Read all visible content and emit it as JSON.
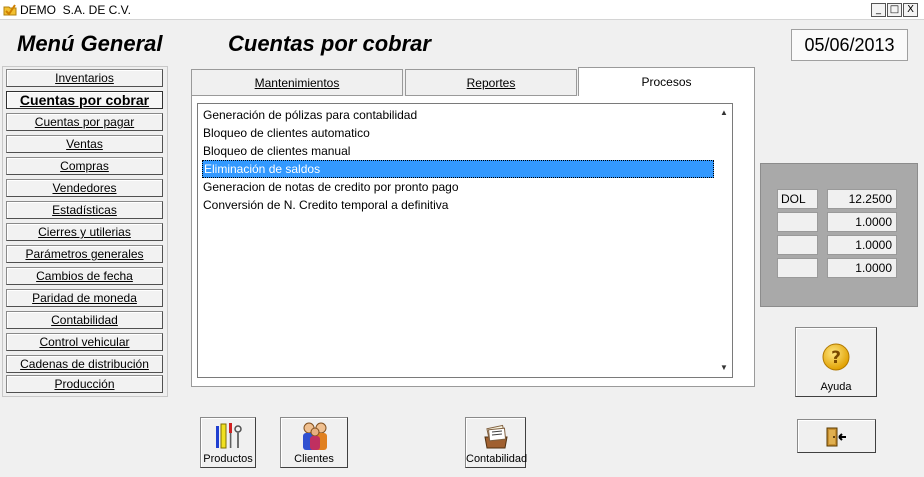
{
  "window": {
    "title": "DEMO  S.A. DE C.V.",
    "minimize": "_",
    "maximize": "□",
    "close": "X"
  },
  "header": {
    "menu_title": "Menú General",
    "section_title": "Cuentas por cobrar",
    "date": "05/06/2013"
  },
  "menu": {
    "items": [
      {
        "label": "Inventarios"
      },
      {
        "label": "Cuentas por cobrar",
        "active": true
      },
      {
        "label": "Cuentas por pagar"
      },
      {
        "label": "Ventas"
      },
      {
        "label": "Compras"
      },
      {
        "label": "Vendedores"
      },
      {
        "label": "Estadísticas"
      },
      {
        "label": "Cierres y utilerias"
      },
      {
        "label": "Parámetros generales"
      },
      {
        "label": "Cambios de fecha"
      },
      {
        "label": "Paridad de moneda"
      },
      {
        "label": "Contabilidad"
      },
      {
        "label": "Control vehicular"
      },
      {
        "label": "Cadenas de distribución"
      },
      {
        "label": "Producción"
      }
    ]
  },
  "tabs": [
    {
      "label": "Mantenimientos"
    },
    {
      "label": "Reportes"
    },
    {
      "label": "Procesos",
      "selected": true
    }
  ],
  "process_list": {
    "items": [
      "Generación de pólizas para contabilidad",
      "Bloqueo de clientes automatico",
      "Bloqueo de clientes manual",
      "Eliminación de saldos",
      "Generacion de notas de credito por pronto pago",
      "Conversión de N. Credito temporal a definitiva"
    ],
    "selected_index": 3
  },
  "exchange_rates": [
    {
      "code": "DOL",
      "value": "12.2500"
    },
    {
      "code": "",
      "value": "1.0000"
    },
    {
      "code": "",
      "value": "1.0000"
    },
    {
      "code": "",
      "value": "1.0000"
    }
  ],
  "buttons": {
    "ayuda": "Ayuda",
    "productos": "Productos",
    "clientes": "Clientes",
    "contabilidad": "Contabilidad"
  },
  "colors": {
    "selection": "#3399ff",
    "rate_panel": "#a9a9a9"
  },
  "icons": {
    "app": "folder-check-icon",
    "help": "question-mark-icon",
    "exit": "door-exit-icon",
    "productos": "tools-icon",
    "clientes": "people-icon",
    "contabilidad": "card-file-icon"
  }
}
